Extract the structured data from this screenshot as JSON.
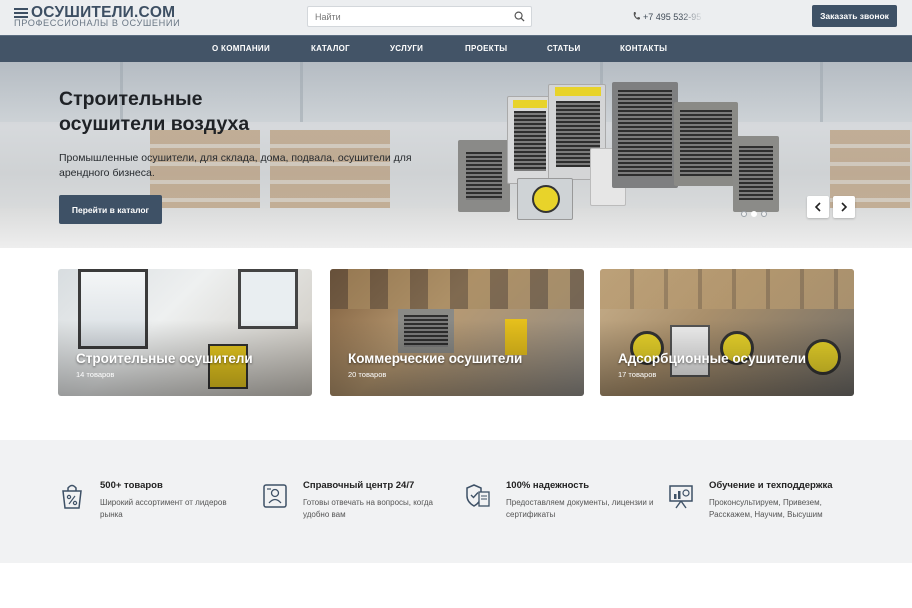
{
  "header": {
    "logo_title": "ОСУШИТЕЛИ.COM",
    "logo_subtitle": "ПРОФЕССИОНАЛЫ В ОСУШЕНИИ",
    "search_placeholder": "Найти",
    "phone": "+7 495 532-95",
    "callback_label": "Заказать звонок"
  },
  "nav": {
    "items": [
      "О КОМПАНИИ",
      "КАТАЛОГ",
      "УСЛУГИ",
      "ПРОЕКТЫ",
      "СТАТЬИ",
      "КОНТАКТЫ"
    ]
  },
  "hero": {
    "title_line1": "Строительные",
    "title_line2": "осушители воздуха",
    "description": "Промышленные осушители, для склада, дома, подвала, осушители для арендного бизнеса.",
    "button_label": "Перейти в каталог",
    "slides_total": 3,
    "active_slide": 2
  },
  "categories": [
    {
      "title": "Строительные осушители",
      "count": "14 товаров"
    },
    {
      "title": "Коммерческие осушители",
      "count": "20 товаров"
    },
    {
      "title": "Адсорбционные осушители",
      "count": "17 товаров"
    }
  ],
  "features": [
    {
      "icon": "shopping-bag-percent-icon",
      "title": "500+ товаров",
      "text": "Широкий ассортимент от лидеров рынка"
    },
    {
      "icon": "support-agent-icon",
      "title": "Справочный центр 24/7",
      "text": "Готовы отвечать на вопросы, когда удобно вам"
    },
    {
      "icon": "shield-document-icon",
      "title": "100% надежность",
      "text": "Предоставляем документы, лицензии и сертификаты"
    },
    {
      "icon": "presentation-board-icon",
      "title": "Обучение и техподдержка",
      "text": "Проконсультируем, Привезем, Расскажем, Научим, Высушим"
    }
  ],
  "colors": {
    "brand_dark": "#3e5166",
    "nav_bg": "#435467",
    "header_bg": "#eceef0",
    "accent_yellow": "#e8d32a"
  }
}
